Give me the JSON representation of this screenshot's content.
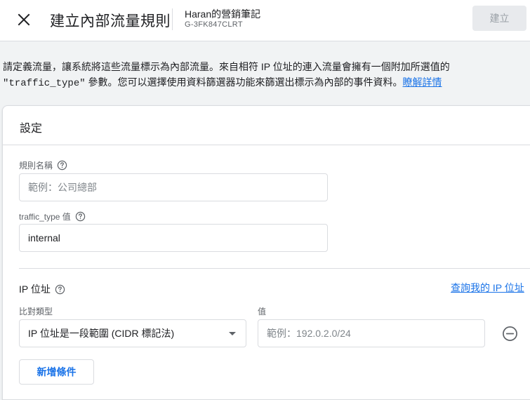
{
  "header": {
    "title": "建立內部流量規則",
    "property_name": "Haran的營銷筆記",
    "property_id": "G-3FK847CLRT",
    "create_label": "建立"
  },
  "description": {
    "text_before": "請定義流量，讓系統將這些流量標示為內部流量。來自相符 IP 位址的連入流量會擁有一個附加所選值的",
    "code": "\"traffic_type\"",
    "text_after": " 參數。您可以選擇使用資料篩選器功能來篩選出標示為內部的事件資料。",
    "link": "瞭解詳情"
  },
  "settings": {
    "title": "設定",
    "rule_name": {
      "label": "規則名稱",
      "placeholder": "範例：公司總部",
      "value": ""
    },
    "traffic_type": {
      "label": "traffic_type 值",
      "value": "internal"
    }
  },
  "ip_section": {
    "title": "IP 位址",
    "lookup_link": "查詢我的 IP 位址",
    "match_type_label": "比對類型",
    "match_type_selected": "IP 位址是一段範圍 (CIDR 標記法)",
    "value_label": "值",
    "value_placeholder": "範例：192.0.2.0/24",
    "add_condition_label": "新增條件"
  },
  "colors": {
    "accent": "#1a73e8",
    "background": "#f1f3f4",
    "border": "#dadce0",
    "muted_text": "#5f6368"
  },
  "icons": {
    "close": "close-icon",
    "help": "help-circle-icon",
    "remove": "remove-circle-icon",
    "dropdown": "dropdown-caret-icon"
  }
}
